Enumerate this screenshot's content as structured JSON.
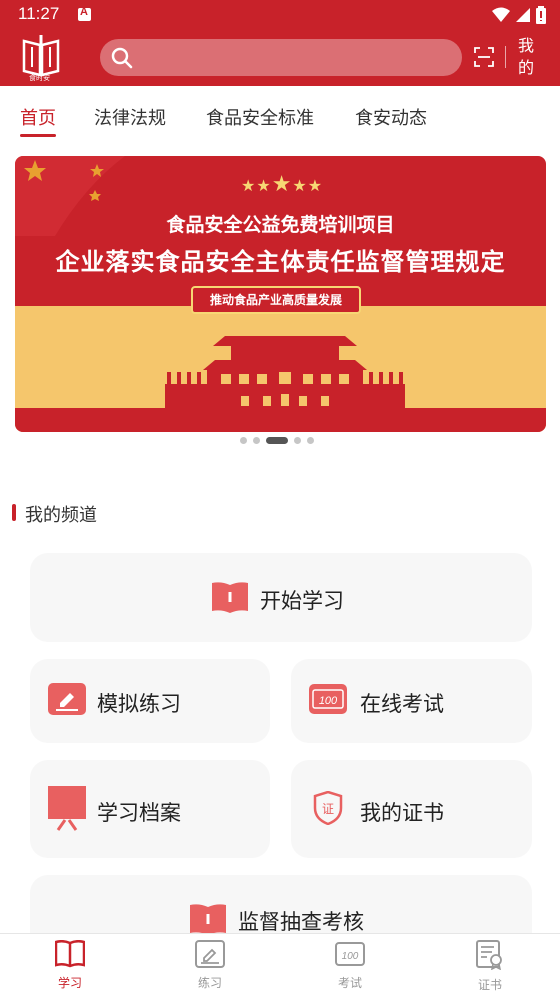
{
  "status_bar": {
    "time": "11:27"
  },
  "header": {
    "logo_text": "食时安",
    "search_placeholder": "",
    "me_label": "我的"
  },
  "tabs": [
    {
      "label": "首页",
      "active": true
    },
    {
      "label": "法律法规",
      "active": false
    },
    {
      "label": "食品安全标准",
      "active": false
    },
    {
      "label": "食安动态",
      "active": false
    }
  ],
  "banner": {
    "subtitle": "食品安全公益免费培训项目",
    "title": "企业落实食品安全主体责任监督管理规定",
    "pill": "推动食品产业高质量发展",
    "page_count": 5,
    "active_page": 3
  },
  "section": {
    "title": "我的频道"
  },
  "cards": {
    "start_learning": "开始学习",
    "mock_practice": "模拟练习",
    "online_exam": "在线考试",
    "learning_archive": "学习档案",
    "my_certificates": "我的证书",
    "supervision_check": "监督抽查考核"
  },
  "bottom_nav": [
    {
      "label": "学习",
      "icon": "book-icon",
      "active": true
    },
    {
      "label": "练习",
      "icon": "edit-icon",
      "active": false
    },
    {
      "label": "考试",
      "icon": "score-icon",
      "active": false
    },
    {
      "label": "证书",
      "icon": "certificate-icon",
      "active": false
    }
  ],
  "colors": {
    "brand_red": "#c8222a",
    "icon_red": "#e86060",
    "banner_yellow": "#f5c66c"
  }
}
